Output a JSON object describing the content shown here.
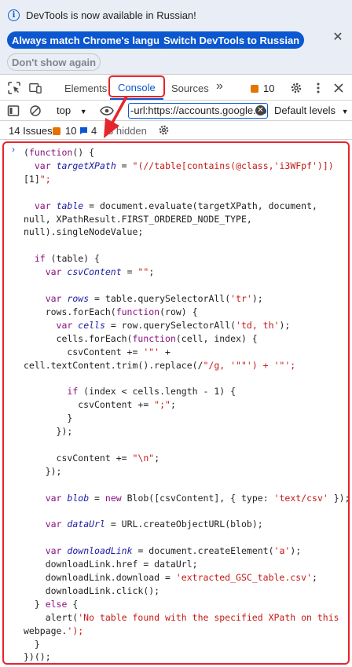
{
  "infobar": {
    "message": "DevTools is now available in Russian!",
    "btn_match": "Always match Chrome's language",
    "btn_switch": "Switch DevTools to Russian",
    "btn_dont_show": "Don't show again"
  },
  "tabs": {
    "elements": "Elements",
    "console": "Console",
    "sources": "Sources",
    "more": "»",
    "issue_count": "10"
  },
  "toolbar": {
    "context": "top",
    "filter_value": "-url:https://accounts.google.co",
    "levels": "Default levels"
  },
  "issues_bar": {
    "label": "14 Issues:",
    "warnings": "10",
    "info": "4",
    "hidden": "3 hidden"
  },
  "code_lines": [
    "(function() {",
    "  var targetXPath = \"(//table[contains(@class,'i3WFpf')])",
    "[1]\";",
    "",
    "  var table = document.evaluate(targetXPath, document,",
    "null, XPathResult.FIRST_ORDERED_NODE_TYPE,",
    "null).singleNodeValue;",
    "",
    "  if (table) {",
    "    var csvContent = \"\";",
    "",
    "    var rows = table.querySelectorAll('tr');",
    "    rows.forEach(function(row) {",
    "      var cells = row.querySelectorAll('td, th');",
    "      cells.forEach(function(cell, index) {",
    "        csvContent += '\"' +",
    "cell.textContent.trim().replace(/\"/g, '\"\"') + '\"';",
    "",
    "        if (index < cells.length - 1) {",
    "          csvContent += \";\";",
    "        }",
    "      });",
    "",
    "      csvContent += \"\\n\";",
    "    });",
    "",
    "    var blob = new Blob([csvContent], { type: 'text/csv' });",
    "",
    "    var dataUrl = URL.createObjectURL(blob);",
    "",
    "    var downloadLink = document.createElement('a');",
    "    downloadLink.href = dataUrl;",
    "    downloadLink.download = 'extracted_GSC_table.csv';",
    "    downloadLink.click();",
    "  } else {",
    "    alert('No table found with the specified XPath on this",
    "webpage.');",
    "  }",
    "})();"
  ]
}
